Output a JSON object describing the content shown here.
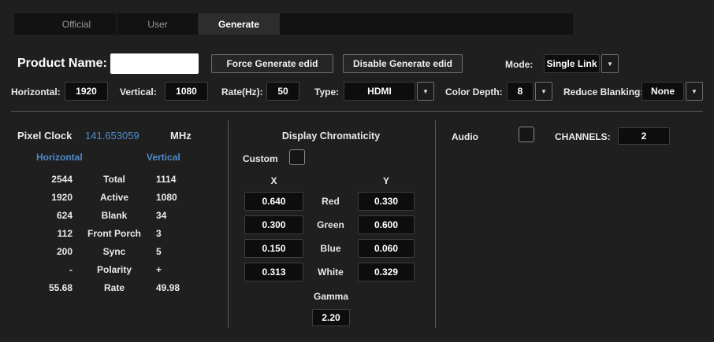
{
  "icons": {
    "chevron_down": "▼"
  },
  "colors": {
    "accent_blue": "#4f8cc9",
    "background": "#1f1f1f"
  },
  "tabs": {
    "official": "Official",
    "user": "User",
    "generate": "Generate"
  },
  "product": {
    "label": "Product Name:",
    "value": "",
    "force_button": "Force Generate edid",
    "disable_button": "Disable Generate edid",
    "mode_label": "Mode:",
    "mode_value": "Single Link"
  },
  "params": {
    "horizontal_label": "Horizontal:",
    "horizontal_value": "1920",
    "vertical_label": "Vertical:",
    "vertical_value": "1080",
    "rate_label": "Rate(Hz):",
    "rate_value": "50",
    "type_label": "Type:",
    "type_value": "HDMI",
    "color_depth_label": "Color Depth:",
    "color_depth_value": "8",
    "reduce_blanking_label": "Reduce Blanking:",
    "reduce_blanking_value": "None"
  },
  "timing": {
    "pixel_clock_label": "Pixel Clock",
    "pixel_clock_value": "141.653059",
    "pixel_clock_unit": "MHz",
    "col_horizontal": "Horizontal",
    "col_vertical": "Vertical",
    "rows": [
      {
        "h": "2544",
        "label": "Total",
        "v": "1114"
      },
      {
        "h": "1920",
        "label": "Active",
        "v": "1080"
      },
      {
        "h": "624",
        "label": "Blank",
        "v": "34"
      },
      {
        "h": "112",
        "label": "Front Porch",
        "v": "3"
      },
      {
        "h": "200",
        "label": "Sync",
        "v": "5"
      },
      {
        "h": "-",
        "label": "Polarity",
        "v": "+"
      },
      {
        "h": "55.68",
        "label": "Rate",
        "v": "49.98"
      }
    ]
  },
  "chromaticity": {
    "title": "Display Chromaticity",
    "custom_label": "Custom",
    "x_header": "X",
    "y_header": "Y",
    "rows": [
      {
        "x": "0.640",
        "label": "Red",
        "y": "0.330"
      },
      {
        "x": "0.300",
        "label": "Green",
        "y": "0.600"
      },
      {
        "x": "0.150",
        "label": "Blue",
        "y": "0.060"
      },
      {
        "x": "0.313",
        "label": "White",
        "y": "0.329"
      }
    ],
    "gamma_label": "Gamma",
    "gamma_value": "2.20"
  },
  "audio": {
    "label": "Audio",
    "channels_label": "CHANNELS:",
    "channels_value": "2"
  }
}
